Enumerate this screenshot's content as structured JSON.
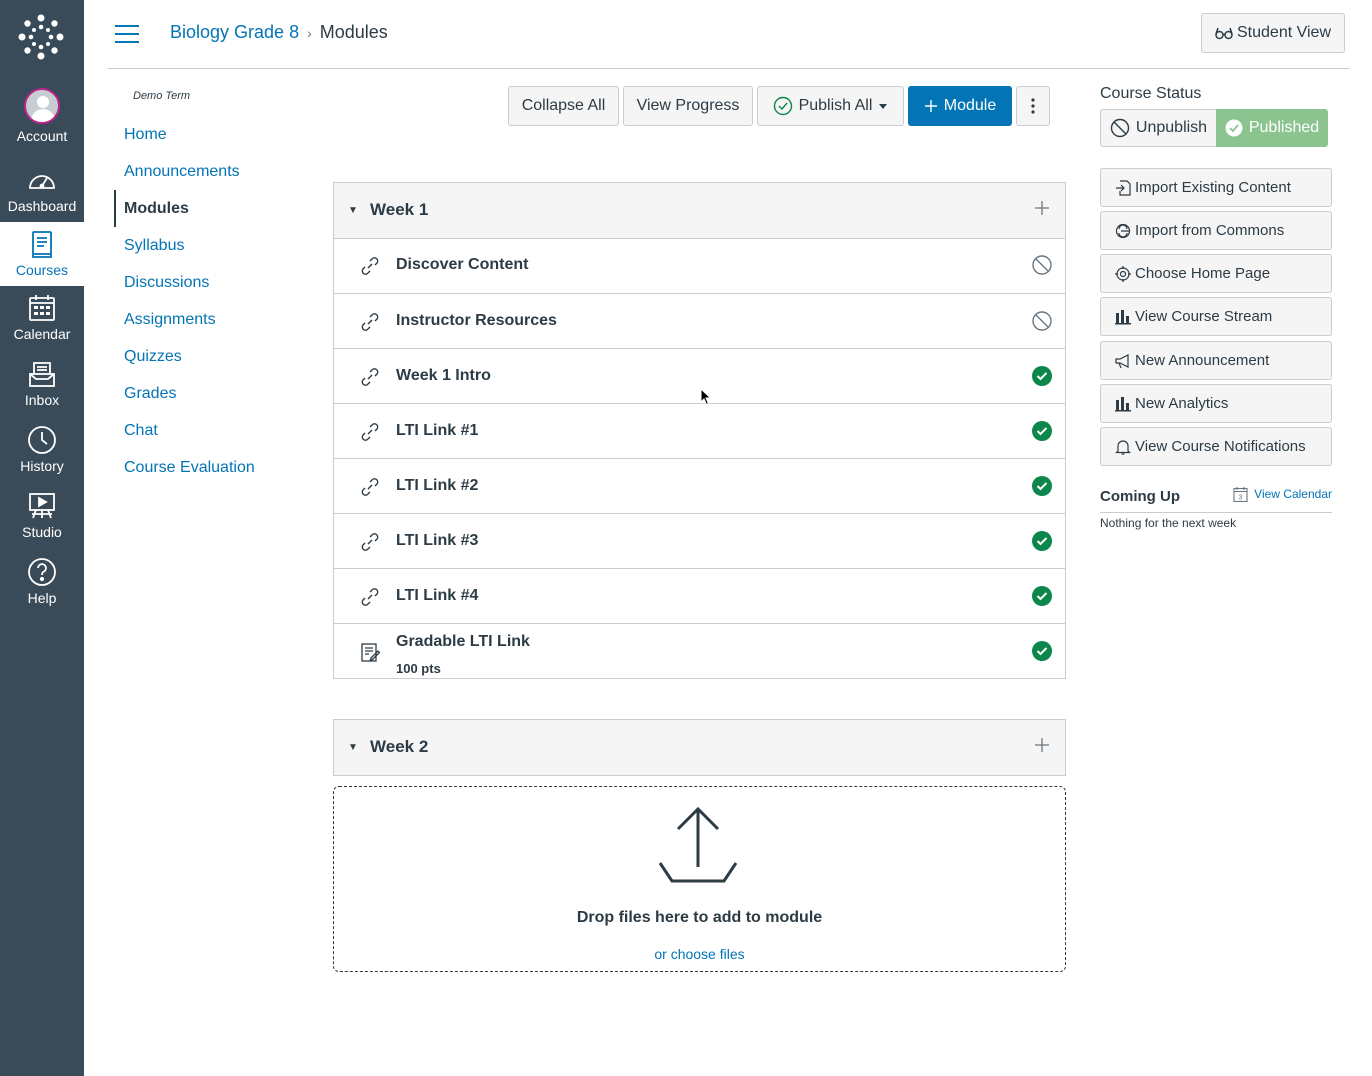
{
  "global_nav": {
    "account": "Account",
    "dashboard": "Dashboard",
    "courses": "Courses",
    "calendar": "Calendar",
    "inbox": "Inbox",
    "history": "History",
    "studio": "Studio",
    "help": "Help"
  },
  "header": {
    "course_link": "Biology Grade 8",
    "separator": "›",
    "current": "Modules",
    "student_view": "Student View"
  },
  "course_nav": {
    "term": "Demo Term",
    "items": [
      "Home",
      "Announcements",
      "Modules",
      "Syllabus",
      "Discussions",
      "Assignments",
      "Quizzes",
      "Grades",
      "Chat",
      "Course Evaluation"
    ],
    "active_index": 2
  },
  "toolbar": {
    "collapse_all": "Collapse All",
    "view_progress": "View Progress",
    "publish_all": "Publish All",
    "module": "Module"
  },
  "modules": [
    {
      "title": "Week 1",
      "items": [
        {
          "title": "Discover Content",
          "type": "link",
          "status": "unpublished"
        },
        {
          "title": "Instructor Resources",
          "type": "link",
          "status": "unpublished"
        },
        {
          "title": "Week 1 Intro",
          "type": "link",
          "status": "published"
        },
        {
          "title": "LTI Link #1",
          "type": "link",
          "status": "published"
        },
        {
          "title": "LTI Link #2",
          "type": "link",
          "status": "published"
        },
        {
          "title": "LTI Link #3",
          "type": "link",
          "status": "published"
        },
        {
          "title": "LTI Link #4",
          "type": "link",
          "status": "published"
        },
        {
          "title": "Gradable LTI Link",
          "points": "100 pts",
          "type": "assignment",
          "status": "published"
        }
      ]
    },
    {
      "title": "Week 2",
      "items": []
    }
  ],
  "dropzone": {
    "text": "Drop files here to add to module",
    "link": "or choose files"
  },
  "sidebar": {
    "course_status": "Course Status",
    "unpublish": "Unpublish",
    "published": "Published",
    "buttons": [
      "Import Existing Content",
      "Import from Commons",
      "Choose Home Page",
      "View Course Stream",
      "New Announcement",
      "New Analytics",
      "View Course Notifications"
    ],
    "coming_up": "Coming Up",
    "view_calendar": "View Calendar",
    "nothing": "Nothing for the next week"
  },
  "colors": {
    "nav_bg": "#394b58",
    "link": "#0374b5",
    "published_green": "#0b874b",
    "published_button": "#8bc48e"
  }
}
